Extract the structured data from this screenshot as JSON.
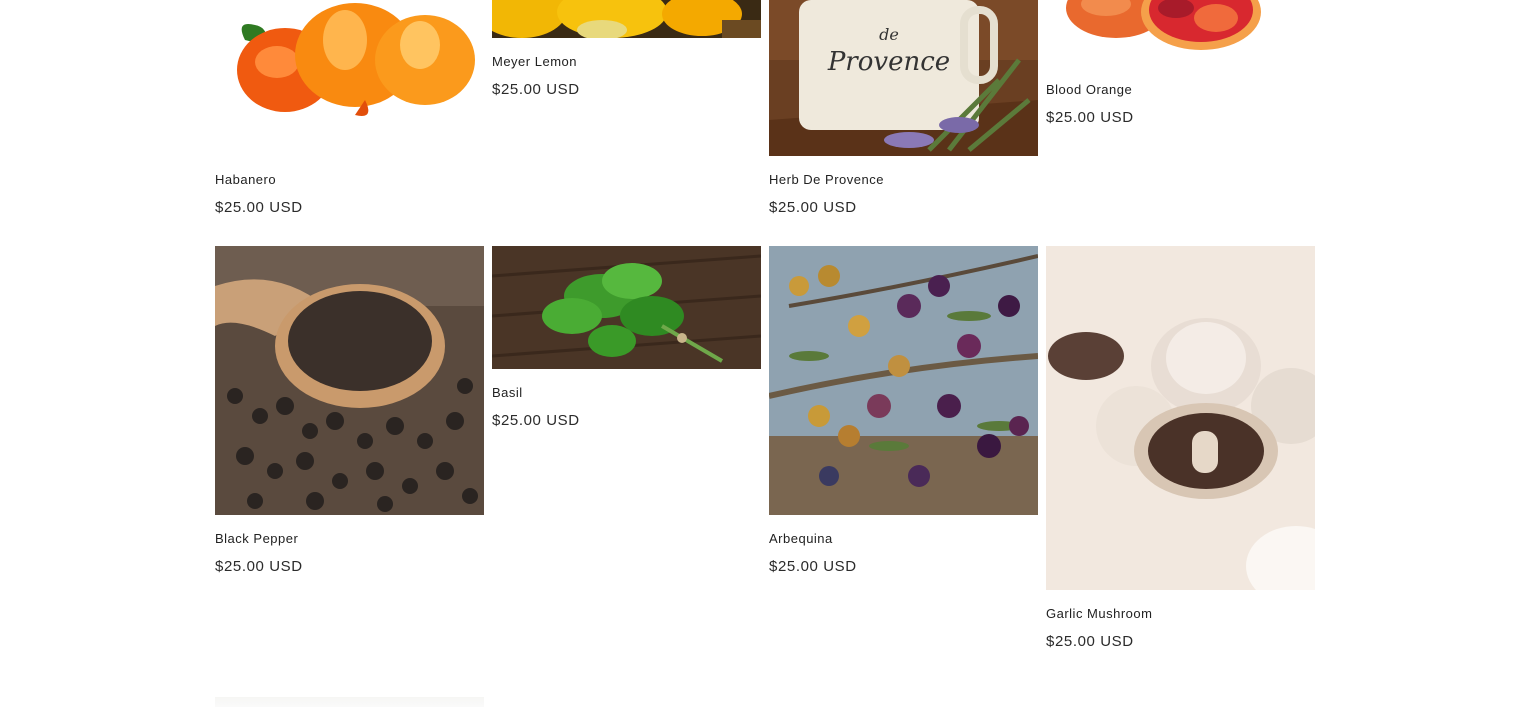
{
  "products": [
    {
      "name": "Habanero",
      "price": "$25.00 USD",
      "image": "habanero-photo"
    },
    {
      "name": "Meyer Lemon",
      "price": "$25.00 USD",
      "image": "meyer-lemon-photo"
    },
    {
      "name": "Herb De Provence",
      "price": "$25.00 USD",
      "image": "herb-de-provence-photo",
      "image_text": "de Provence"
    },
    {
      "name": "Blood Orange",
      "price": "$25.00 USD",
      "image": "blood-orange-photo"
    },
    {
      "name": "Black Pepper",
      "price": "$25.00 USD",
      "image": "black-pepper-photo"
    },
    {
      "name": "Basil",
      "price": "$25.00 USD",
      "image": "basil-photo"
    },
    {
      "name": "Arbequina",
      "price": "$25.00 USD",
      "image": "arbequina-olives-photo"
    },
    {
      "name": "Garlic Mushroom",
      "price": "$25.00 USD",
      "image": "garlic-mushroom-photo"
    }
  ]
}
